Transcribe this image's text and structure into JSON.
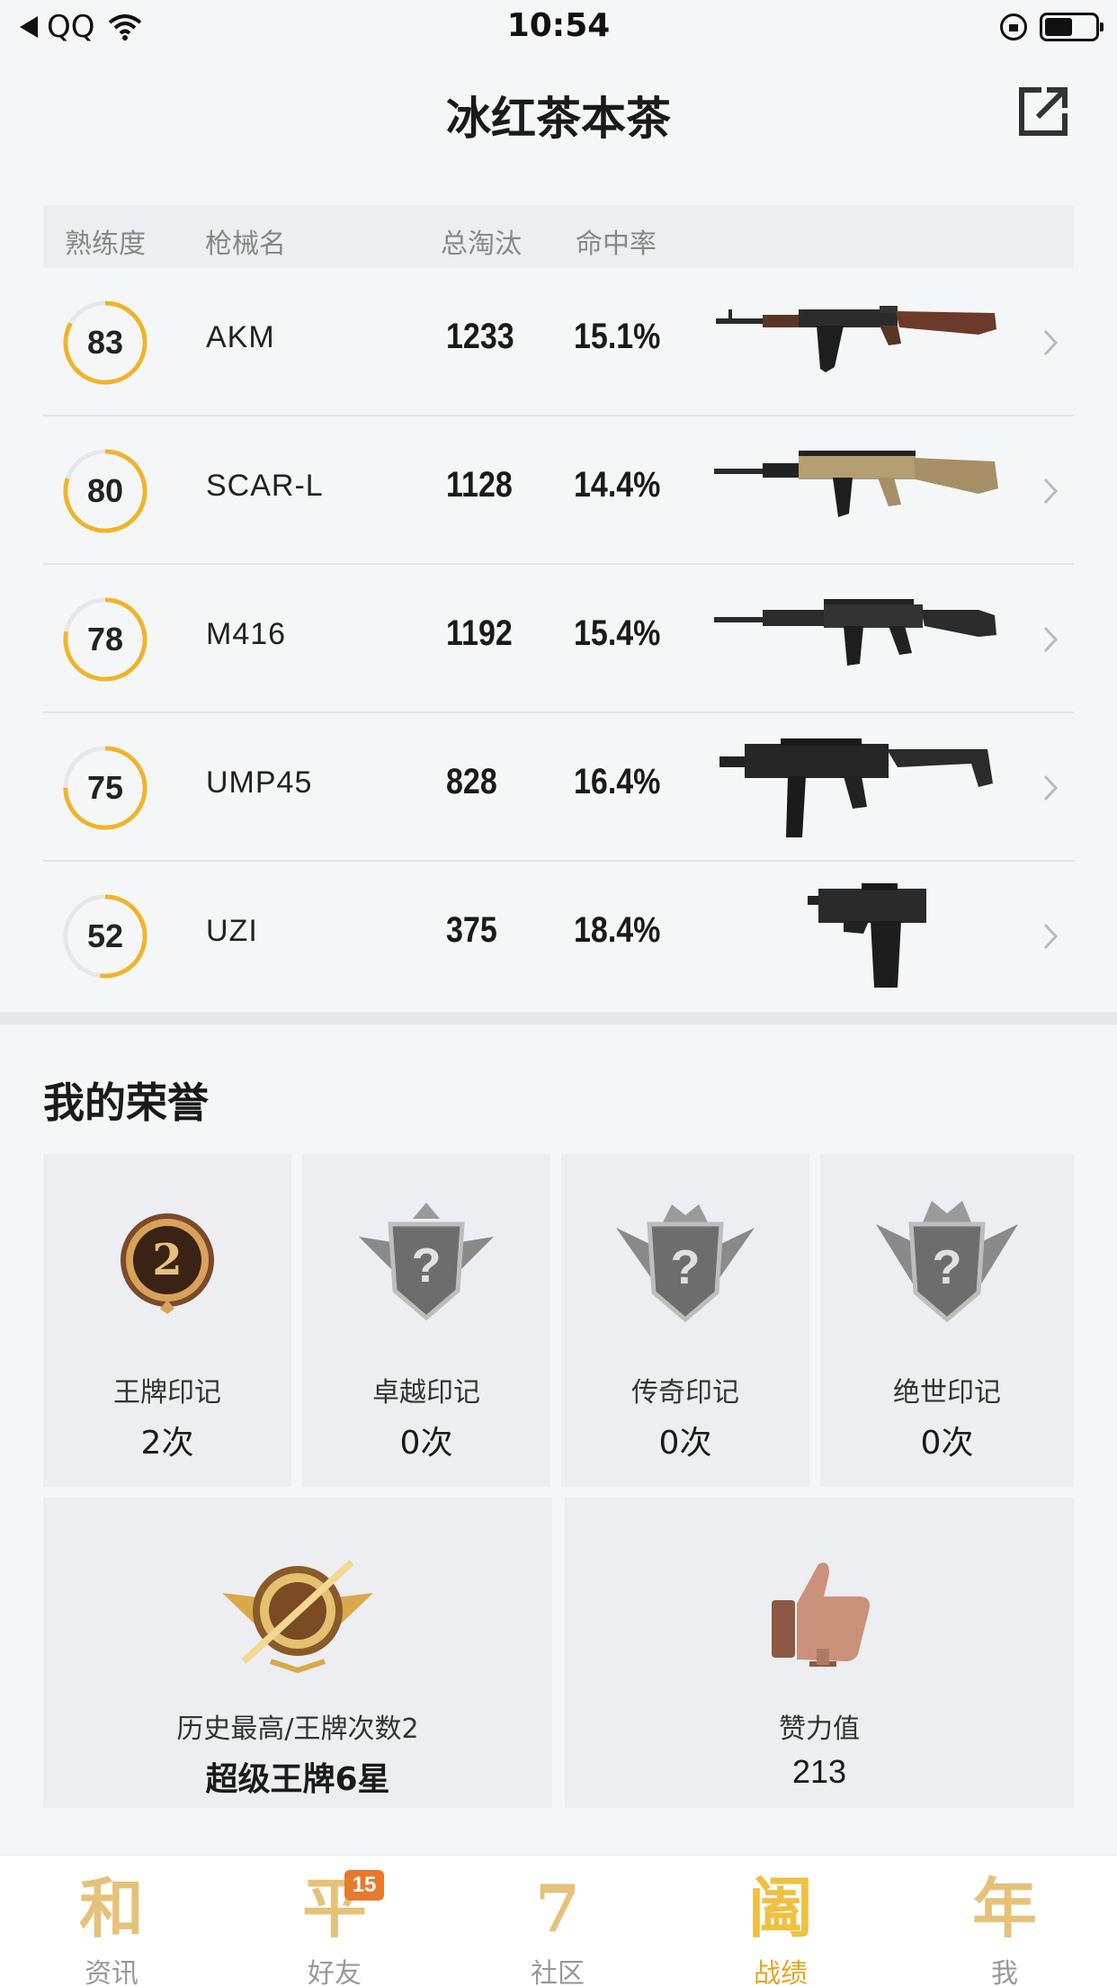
{
  "status_bar": {
    "carrier": "QQ",
    "time": "10:54"
  },
  "header": {
    "title": "冰红茶本茶"
  },
  "table": {
    "headers": {
      "proficiency": "熟练度",
      "gun": "枪械名",
      "kills": "总淘汰",
      "accuracy": "命中率"
    },
    "rows": [
      {
        "proficiency": "83",
        "gun": "AKM",
        "kills": "1233",
        "accuracy": "15.1%",
        "level": 0.83
      },
      {
        "proficiency": "80",
        "gun": "SCAR-L",
        "kills": "1128",
        "accuracy": "14.4%",
        "level": 0.8
      },
      {
        "proficiency": "78",
        "gun": "M416",
        "kills": "1192",
        "accuracy": "15.4%",
        "level": 0.78
      },
      {
        "proficiency": "75",
        "gun": "UMP45",
        "kills": "828",
        "accuracy": "16.4%",
        "level": 0.75
      },
      {
        "proficiency": "52",
        "gun": "UZI",
        "kills": "375",
        "accuracy": "18.4%",
        "level": 0.52
      }
    ]
  },
  "honors": {
    "title": "我的荣誉",
    "marks": [
      {
        "label": "王牌印记",
        "count": "2次",
        "badge": "2"
      },
      {
        "label": "卓越印记",
        "count": "0次",
        "badge": "?"
      },
      {
        "label": "传奇印记",
        "count": "0次",
        "badge": "?"
      },
      {
        "label": "绝世印记",
        "count": "0次",
        "badge": "?"
      }
    ],
    "history": {
      "label": "历史最高/王牌次数2",
      "value": "超级王牌6星"
    },
    "likes": {
      "label": "赞力值",
      "value": "213"
    }
  },
  "tabbar": {
    "tabs": [
      {
        "glyph": "和",
        "label": "资讯"
      },
      {
        "glyph": "平",
        "label": "好友",
        "badge": "15"
      },
      {
        "glyph": "7",
        "label": "社区"
      },
      {
        "glyph": "阖",
        "label": "战绩"
      },
      {
        "glyph": "年",
        "label": "我"
      }
    ],
    "active_index": 3
  },
  "colors": {
    "ring": "#f0b429",
    "ring_track": "#e6e7ea",
    "accent": "#e6a520"
  }
}
